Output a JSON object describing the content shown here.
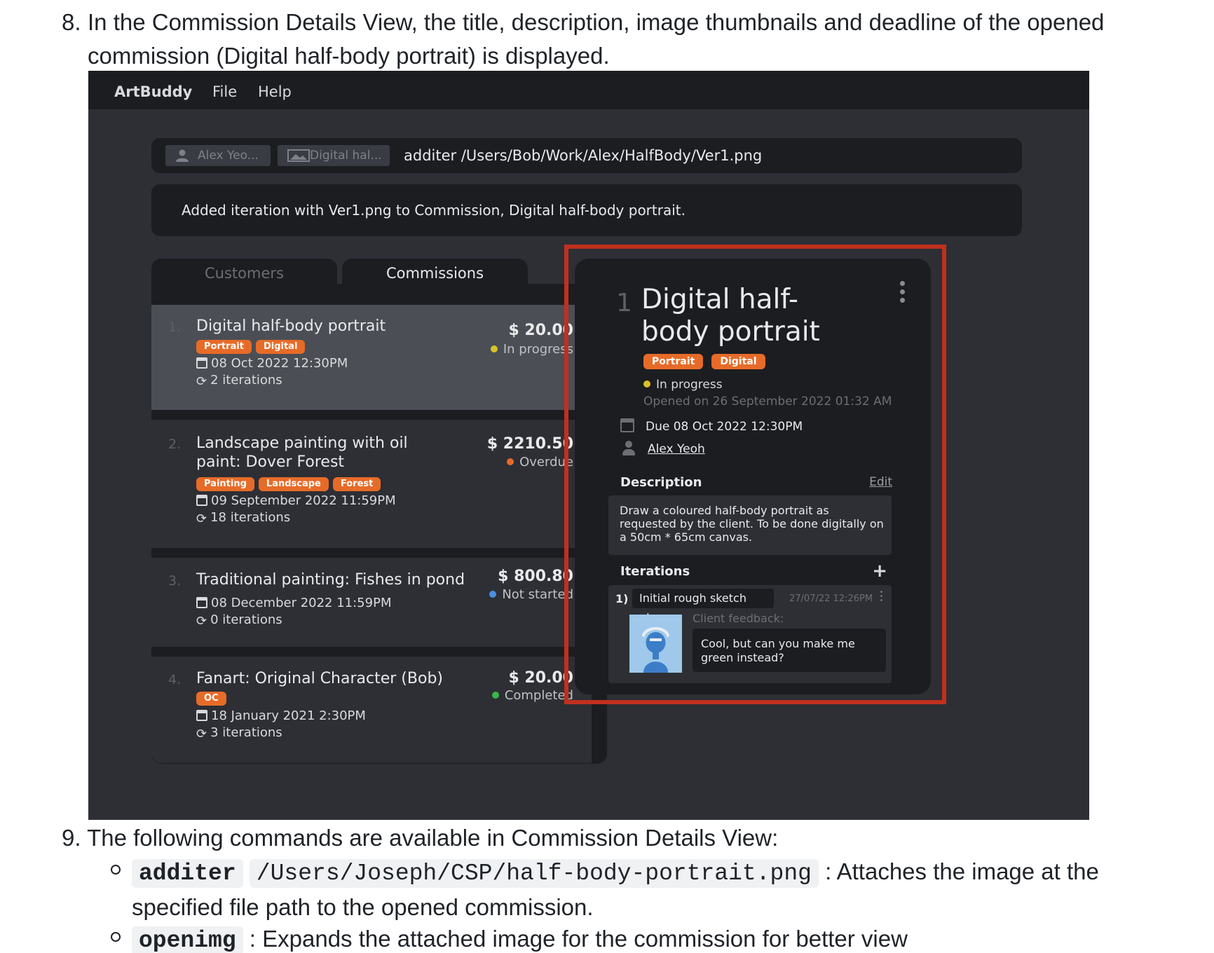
{
  "doc": {
    "step8": {
      "number": "8.",
      "text": "In the Commission Details View, the title, description, image thumbnails and deadline of the opened commission (Digital half-body portrait) is displayed."
    },
    "step9": {
      "number": "9.",
      "text": "The following commands are available in Commission Details View:"
    },
    "commands": [
      {
        "command": "additer",
        "argument": "/Users/Joseph/CSP/half-body-portrait.png",
        "description": ": Attaches the image at the specified file path to the opened commission."
      },
      {
        "command": "openimg",
        "description": ": Expands the attached image for the commission for better view"
      }
    ]
  },
  "app": {
    "menubar": {
      "app_name": "ArtBuddy",
      "file": "File",
      "help": "Help"
    },
    "command_box": {
      "customer_chip": "Alex Yeo...",
      "commission_chip": "Digital hal...",
      "command_text": "additer /Users/Bob/Work/Alex/HalfBody/Ver1.png"
    },
    "result": "Added iteration with Ver1.png to Commission, Digital half-body portrait.",
    "tabs": {
      "customers": "Customers",
      "commissions": "Commissions"
    },
    "commissions": [
      {
        "index": "1.",
        "title": "Digital half-body portrait",
        "price": "$ 20.00",
        "status": "In progress",
        "status_color": "#d8c22c",
        "tags": [
          "Portrait",
          "Digital"
        ],
        "deadline": "08 Oct 2022 12:30PM",
        "iterations": "2 iterations"
      },
      {
        "index": "2.",
        "title": "Landscape painting with oil paint: Dover Forest",
        "price": "$ 2210.50",
        "status": "Overdue",
        "status_color": "#e76b28",
        "tags": [
          "Painting",
          "Landscape",
          "Forest"
        ],
        "deadline": "09 September 2022 11:59PM",
        "iterations": "18 iterations"
      },
      {
        "index": "3.",
        "title": "Traditional painting: Fishes in pond",
        "price": "$ 800.80",
        "status": "Not started",
        "status_color": "#4a90e2",
        "tags": [],
        "deadline": "08 December 2022 11:59PM",
        "iterations": "0 iterations"
      },
      {
        "index": "4.",
        "title": "Fanart: Original Character (Bob)",
        "price": "$ 20.00",
        "status": "Completed",
        "status_color": "#3bb54a",
        "tags": [
          "OC"
        ],
        "deadline": "18 January 2021 2:30PM",
        "iterations": "3 iterations"
      }
    ],
    "detail": {
      "number": "1",
      "title": "Digital half-body portrait",
      "tags": [
        "Portrait",
        "Digital"
      ],
      "status": "In progress",
      "status_color": "#d8c22c",
      "opened": "Opened on 26 September 2022 01:32 AM",
      "due": "Due 08 Oct 2022 12:30PM",
      "customer": "Alex Yeoh",
      "description_label": "Description",
      "edit_label": "Edit",
      "description": "Draw a coloured half-body portrait as requested by the client. To be done digitally on a 50cm * 65cm canvas.",
      "iterations_label": "Iterations",
      "iteration": {
        "number": "1)",
        "name": "Initial rough sketch plan",
        "date": "27/07/22 12:26PM",
        "feedback_label": "Client feedback:",
        "feedback": "Cool, but can you make me green instead?"
      }
    }
  },
  "colors": {
    "highlight": "#c0301e",
    "tag": "#e76b28",
    "panel": "#1c1d21",
    "background": "#2d2f35"
  }
}
